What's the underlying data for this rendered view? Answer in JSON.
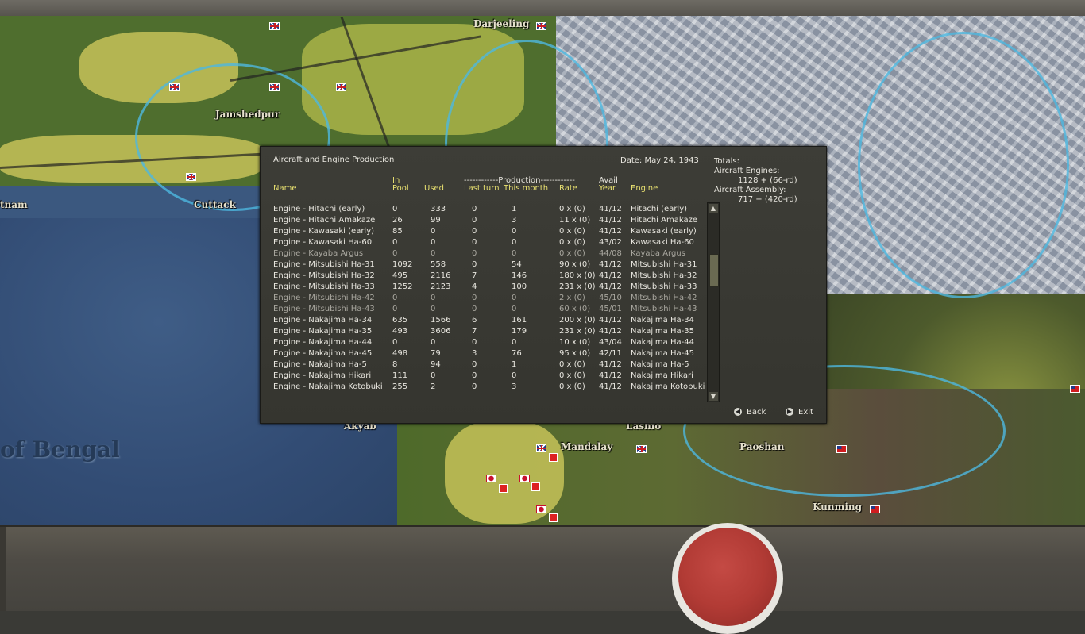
{
  "map": {
    "cities": {
      "darjeeling": "Darjeeling",
      "jamshedpur": "Jamshedpur",
      "cuttack": "Cuttack",
      "vietnam_partial": "tnam",
      "akyab": "Akyab",
      "lashio": "Lashio",
      "mandalay": "Mandalay",
      "paoshan": "Paoshan",
      "kunming": "Kunming"
    },
    "sea_label": "of Bengal"
  },
  "dialog": {
    "title": "Aircraft and Engine Production",
    "date": "Date: May 24, 1943",
    "totals": {
      "label": "Totals:",
      "engines_label": "Aircraft Engines:",
      "engines_value": "1128 + (66-rd)",
      "assembly_label": "Aircraft Assembly:",
      "assembly_value": "717 + (420-rd)"
    },
    "headers": {
      "name": "Name",
      "in": "In",
      "pool": "Pool",
      "used": "Used",
      "production_group": "------------Production------------",
      "last_turn": "Last turn",
      "this_month": "This month",
      "rate": "Rate",
      "avail": "Avail",
      "year": "Year",
      "engine": "Engine"
    },
    "rows": [
      {
        "name": "Engine - Hitachi (early)",
        "pool": "0",
        "used": "333",
        "last": "0",
        "month": "1",
        "rate": "0 x (0)",
        "year": "41/12",
        "engine": "Hitachi (early)",
        "dim": false
      },
      {
        "name": "Engine - Hitachi Amakaze",
        "pool": "26",
        "used": "99",
        "last": "0",
        "month": "3",
        "rate": "11 x (0)",
        "year": "41/12",
        "engine": "Hitachi Amakaze",
        "dim": false
      },
      {
        "name": "Engine - Kawasaki (early)",
        "pool": "85",
        "used": "0",
        "last": "0",
        "month": "0",
        "rate": "0 x (0)",
        "year": "41/12",
        "engine": "Kawasaki (early)",
        "dim": false
      },
      {
        "name": "Engine - Kawasaki Ha-60",
        "pool": "0",
        "used": "0",
        "last": "0",
        "month": "0",
        "rate": "0 x (0)",
        "year": "43/02",
        "engine": "Kawasaki Ha-60",
        "dim": false
      },
      {
        "name": "Engine - Kayaba Argus",
        "pool": "0",
        "used": "0",
        "last": "0",
        "month": "0",
        "rate": "0 x (0)",
        "year": "44/08",
        "engine": "Kayaba Argus",
        "dim": true
      },
      {
        "name": "Engine - Mitsubishi Ha-31",
        "pool": "1092",
        "used": "558",
        "last": "0",
        "month": "54",
        "rate": "90 x (0)",
        "year": "41/12",
        "engine": "Mitsubishi Ha-31",
        "dim": false
      },
      {
        "name": "Engine - Mitsubishi Ha-32",
        "pool": "495",
        "used": "2116",
        "last": "7",
        "month": "146",
        "rate": "180 x (0)",
        "year": "41/12",
        "engine": "Mitsubishi Ha-32",
        "dim": false
      },
      {
        "name": "Engine - Mitsubishi Ha-33",
        "pool": "1252",
        "used": "2123",
        "last": "4",
        "month": "100",
        "rate": "231 x (0)",
        "year": "41/12",
        "engine": "Mitsubishi Ha-33",
        "dim": false
      },
      {
        "name": "Engine - Mitsubishi Ha-42",
        "pool": "0",
        "used": "0",
        "last": "0",
        "month": "0",
        "rate": "2 x (0)",
        "year": "45/10",
        "engine": "Mitsubishi Ha-42",
        "dim": true
      },
      {
        "name": "Engine - Mitsubishi Ha-43",
        "pool": "0",
        "used": "0",
        "last": "0",
        "month": "0",
        "rate": "60 x (0)",
        "year": "45/01",
        "engine": "Mitsubishi Ha-43",
        "dim": true
      },
      {
        "name": "Engine - Nakajima Ha-34",
        "pool": "635",
        "used": "1566",
        "last": "6",
        "month": "161",
        "rate": "200 x (0)",
        "year": "41/12",
        "engine": "Nakajima Ha-34",
        "dim": false
      },
      {
        "name": "Engine - Nakajima Ha-35",
        "pool": "493",
        "used": "3606",
        "last": "7",
        "month": "179",
        "rate": "231 x (0)",
        "year": "41/12",
        "engine": "Nakajima Ha-35",
        "dim": false
      },
      {
        "name": "Engine - Nakajima Ha-44",
        "pool": "0",
        "used": "0",
        "last": "0",
        "month": "0",
        "rate": "10 x (0)",
        "year": "43/04",
        "engine": "Nakajima Ha-44",
        "dim": false
      },
      {
        "name": "Engine - Nakajima Ha-45",
        "pool": "498",
        "used": "79",
        "last": "3",
        "month": "76",
        "rate": "95 x (0)",
        "year": "42/11",
        "engine": "Nakajima Ha-45",
        "dim": false
      },
      {
        "name": "Engine - Nakajima Ha-5",
        "pool": "8",
        "used": "94",
        "last": "0",
        "month": "1",
        "rate": "0 x (0)",
        "year": "41/12",
        "engine": "Nakajima Ha-5",
        "dim": false
      },
      {
        "name": "Engine - Nakajima Hikari",
        "pool": "111",
        "used": "0",
        "last": "0",
        "month": "0",
        "rate": "0 x (0)",
        "year": "41/12",
        "engine": "Nakajima Hikari",
        "dim": false
      },
      {
        "name": "Engine - Nakajima Kotobuki",
        "pool": "255",
        "used": "2",
        "last": "0",
        "month": "3",
        "rate": "0 x (0)",
        "year": "41/12",
        "engine": "Nakajima Kotobuki",
        "dim": false
      }
    ],
    "buttons": {
      "back": "Back",
      "exit": "Exit"
    }
  },
  "colors": {
    "header_text": "#e8e070",
    "dim_text": "#a9a79f",
    "dialog_bg": "#3a3a34"
  }
}
